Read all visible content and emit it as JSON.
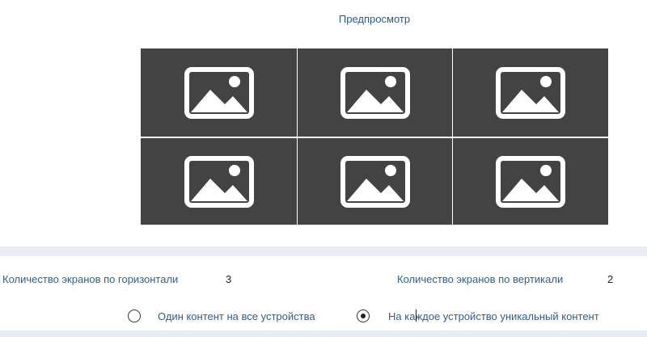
{
  "preview": {
    "title": "Предпросмотр",
    "tiles": [
      {
        "icon": "image-placeholder-icon"
      },
      {
        "icon": "image-placeholder-icon"
      },
      {
        "icon": "image-placeholder-icon"
      },
      {
        "icon": "image-placeholder-icon"
      },
      {
        "icon": "image-placeholder-icon"
      },
      {
        "icon": "image-placeholder-icon"
      }
    ]
  },
  "settings": {
    "horizontal_label": "Количество экранов по горизонтали",
    "horizontal_value": "3",
    "vertical_label": "Количество экранов по вертикали",
    "vertical_value": "2"
  },
  "content_mode": {
    "options": [
      {
        "label": "Один контент на все устройства",
        "selected": false
      },
      {
        "label": "На каждое устройство уникальный контент",
        "selected": true
      }
    ]
  },
  "colors": {
    "tile_background": "#434343",
    "label_text": "#2a5f98",
    "section_band": "#e9edf3"
  }
}
